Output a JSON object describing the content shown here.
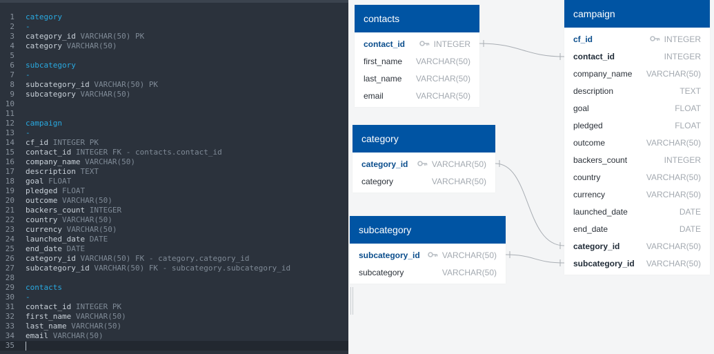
{
  "editor": {
    "lines": [
      {
        "n": "1",
        "parts": [
          {
            "t": "category",
            "c": "head"
          }
        ]
      },
      {
        "n": "2",
        "parts": [
          {
            "t": "-",
            "c": "dash"
          }
        ]
      },
      {
        "n": "3",
        "parts": [
          {
            "t": "category_id ",
            "c": "name"
          },
          {
            "t": "VARCHAR(50) PK",
            "c": "type"
          }
        ]
      },
      {
        "n": "4",
        "parts": [
          {
            "t": "category ",
            "c": "name"
          },
          {
            "t": "VARCHAR(50)",
            "c": "type"
          }
        ]
      },
      {
        "n": "5",
        "parts": []
      },
      {
        "n": "6",
        "parts": [
          {
            "t": "subcategory",
            "c": "head"
          }
        ]
      },
      {
        "n": "7",
        "parts": [
          {
            "t": "-",
            "c": "dash"
          }
        ]
      },
      {
        "n": "8",
        "parts": [
          {
            "t": "subcategory_id ",
            "c": "name"
          },
          {
            "t": "VARCHAR(50) PK",
            "c": "type"
          }
        ]
      },
      {
        "n": "9",
        "parts": [
          {
            "t": "subcategory ",
            "c": "name"
          },
          {
            "t": "VARCHAR(50)",
            "c": "type"
          }
        ]
      },
      {
        "n": "10",
        "parts": []
      },
      {
        "n": "11",
        "parts": []
      },
      {
        "n": "12",
        "parts": [
          {
            "t": "campaign",
            "c": "head"
          }
        ]
      },
      {
        "n": "13",
        "parts": [
          {
            "t": "-",
            "c": "dash"
          }
        ]
      },
      {
        "n": "14",
        "parts": [
          {
            "t": "cf_id ",
            "c": "name"
          },
          {
            "t": "INTEGER PK",
            "c": "type"
          }
        ]
      },
      {
        "n": "15",
        "parts": [
          {
            "t": "contact_id ",
            "c": "name"
          },
          {
            "t": "INTEGER FK - contacts.contact_id",
            "c": "type"
          }
        ]
      },
      {
        "n": "16",
        "parts": [
          {
            "t": "company_name ",
            "c": "name"
          },
          {
            "t": "VARCHAR(50)",
            "c": "type"
          }
        ]
      },
      {
        "n": "17",
        "parts": [
          {
            "t": "description ",
            "c": "name"
          },
          {
            "t": "TEXT",
            "c": "type"
          }
        ]
      },
      {
        "n": "18",
        "parts": [
          {
            "t": "goal ",
            "c": "name"
          },
          {
            "t": "FLOAT",
            "c": "type"
          }
        ]
      },
      {
        "n": "19",
        "parts": [
          {
            "t": "pledged ",
            "c": "name"
          },
          {
            "t": "FLOAT",
            "c": "type"
          }
        ]
      },
      {
        "n": "20",
        "parts": [
          {
            "t": "outcome ",
            "c": "name"
          },
          {
            "t": "VARCHAR(50)",
            "c": "type"
          }
        ]
      },
      {
        "n": "21",
        "parts": [
          {
            "t": "backers_count ",
            "c": "name"
          },
          {
            "t": "INTEGER",
            "c": "type"
          }
        ]
      },
      {
        "n": "22",
        "parts": [
          {
            "t": "country ",
            "c": "name"
          },
          {
            "t": "VARCHAR(50)",
            "c": "type"
          }
        ]
      },
      {
        "n": "23",
        "parts": [
          {
            "t": "currency ",
            "c": "name"
          },
          {
            "t": "VARCHAR(50)",
            "c": "type"
          }
        ]
      },
      {
        "n": "24",
        "parts": [
          {
            "t": "launched_date ",
            "c": "name"
          },
          {
            "t": "DATE",
            "c": "type"
          }
        ]
      },
      {
        "n": "25",
        "parts": [
          {
            "t": "end_date ",
            "c": "name"
          },
          {
            "t": "DATE",
            "c": "type"
          }
        ]
      },
      {
        "n": "26",
        "parts": [
          {
            "t": "category_id ",
            "c": "name"
          },
          {
            "t": "VARCHAR(50) FK - category.category_id",
            "c": "type"
          }
        ]
      },
      {
        "n": "27",
        "parts": [
          {
            "t": "subcategory_id ",
            "c": "name"
          },
          {
            "t": "VARCHAR(50) FK - subcategory.subcategory_id",
            "c": "type"
          }
        ]
      },
      {
        "n": "28",
        "parts": []
      },
      {
        "n": "29",
        "parts": [
          {
            "t": "contacts",
            "c": "head"
          }
        ]
      },
      {
        "n": "30",
        "parts": [
          {
            "t": "-",
            "c": "dash"
          }
        ]
      },
      {
        "n": "31",
        "parts": [
          {
            "t": "contact_id ",
            "c": "name"
          },
          {
            "t": "INTEGER PK",
            "c": "type"
          }
        ]
      },
      {
        "n": "32",
        "parts": [
          {
            "t": "first_name ",
            "c": "name"
          },
          {
            "t": "VARCHAR(50)",
            "c": "type"
          }
        ]
      },
      {
        "n": "33",
        "parts": [
          {
            "t": "last_name ",
            "c": "name"
          },
          {
            "t": "VARCHAR(50)",
            "c": "type"
          }
        ]
      },
      {
        "n": "34",
        "parts": [
          {
            "t": "email ",
            "c": "name"
          },
          {
            "t": "VARCHAR(50)",
            "c": "type"
          }
        ]
      },
      {
        "n": "35",
        "parts": [],
        "current": true
      }
    ]
  },
  "diagram": {
    "colors": {
      "header": "#0054a3",
      "connector": "#a8adb3"
    },
    "tables": {
      "contacts": {
        "title": "contacts",
        "rows": [
          {
            "name": "contact_id",
            "type": "INTEGER",
            "key": "pk"
          },
          {
            "name": "first_name",
            "type": "VARCHAR(50)"
          },
          {
            "name": "last_name",
            "type": "VARCHAR(50)"
          },
          {
            "name": "email",
            "type": "VARCHAR(50)"
          }
        ]
      },
      "category": {
        "title": "category",
        "rows": [
          {
            "name": "category_id",
            "type": "VARCHAR(50)",
            "key": "pk"
          },
          {
            "name": "category",
            "type": "VARCHAR(50)"
          }
        ]
      },
      "subcategory": {
        "title": "subcategory",
        "rows": [
          {
            "name": "subcategory_id",
            "type": "VARCHAR(50)",
            "key": "pk"
          },
          {
            "name": "subcategory",
            "type": "VARCHAR(50)"
          }
        ]
      },
      "campaign": {
        "title": "campaign",
        "rows": [
          {
            "name": "cf_id",
            "type": "INTEGER",
            "key": "pk"
          },
          {
            "name": "contact_id",
            "type": "INTEGER",
            "key": "fk"
          },
          {
            "name": "company_name",
            "type": "VARCHAR(50)"
          },
          {
            "name": "description",
            "type": "TEXT"
          },
          {
            "name": "goal",
            "type": "FLOAT"
          },
          {
            "name": "pledged",
            "type": "FLOAT"
          },
          {
            "name": "outcome",
            "type": "VARCHAR(50)"
          },
          {
            "name": "backers_count",
            "type": "INTEGER"
          },
          {
            "name": "country",
            "type": "VARCHAR(50)"
          },
          {
            "name": "currency",
            "type": "VARCHAR(50)"
          },
          {
            "name": "launched_date",
            "type": "DATE"
          },
          {
            "name": "end_date",
            "type": "DATE"
          },
          {
            "name": "category_id",
            "type": "VARCHAR(50)",
            "key": "fk"
          },
          {
            "name": "subcategory_id",
            "type": "VARCHAR(50)",
            "key": "fk"
          }
        ]
      }
    }
  }
}
